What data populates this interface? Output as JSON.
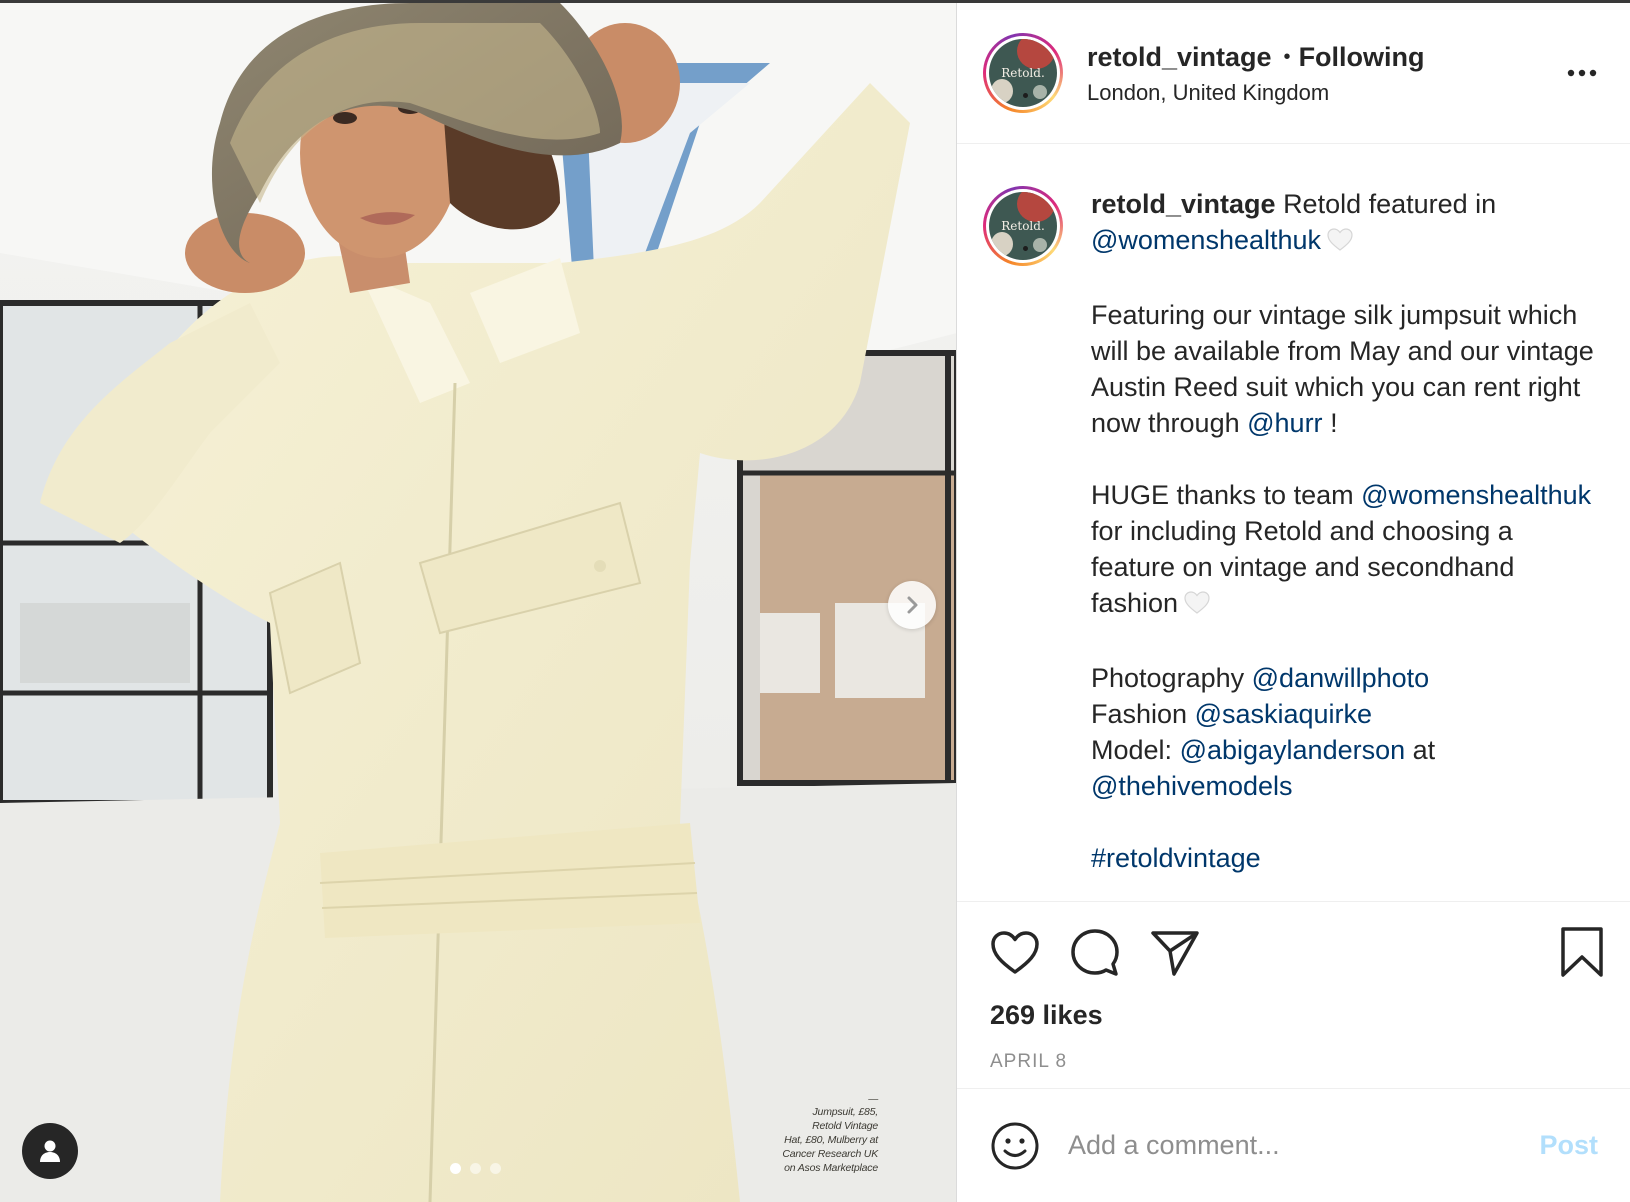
{
  "post": {
    "photo": {
      "credits_rule": "—",
      "credits_lines": [
        "Jumpsuit, £85,",
        "Retold Vintage",
        "Hat, £80, Mulberry at",
        "Cancer Research UK",
        "on Asos Marketplace"
      ],
      "carousel_count": 3,
      "carousel_active_index": 0
    },
    "header": {
      "username": "retold_vintage",
      "separator": "•",
      "follow_status": "Following",
      "location": "London, United Kingdom",
      "avatar_text": "Retold."
    },
    "caption": {
      "username": "retold_vintage",
      "line1_text": "Retold featured in",
      "line1_mention": "@womenshealthuk",
      "para2_text": "Featuring our vintage silk jumpsuit which will be available from May and our vintage Austin Reed suit which you can rent right now through",
      "para2_mention": "@hurr",
      "para2_end": "!",
      "para3_start": "HUGE thanks to team",
      "para3_mention": "@womenshealthuk",
      "para3_end": "for including Retold and choosing a feature on vintage and secondhand fashion",
      "photography_label": "Photography",
      "photography_mention": "@danwillphoto",
      "fashion_label": "Fashion",
      "fashion_mention": "@saskiaquirke",
      "model_label": "Model:",
      "model_mention": "@abigaylanderson",
      "model_at": "at",
      "agency_mention": "@thehivemodels",
      "hashtag": "#retoldvintage"
    },
    "actions": {
      "likes": "269 likes",
      "date": "APRIL 8"
    },
    "comment": {
      "placeholder": "Add a comment...",
      "post_label": "Post"
    }
  },
  "colors": {
    "mention": "#00376b",
    "post_disabled": "#b2dffc",
    "secondary_text": "#8e8e8e"
  }
}
